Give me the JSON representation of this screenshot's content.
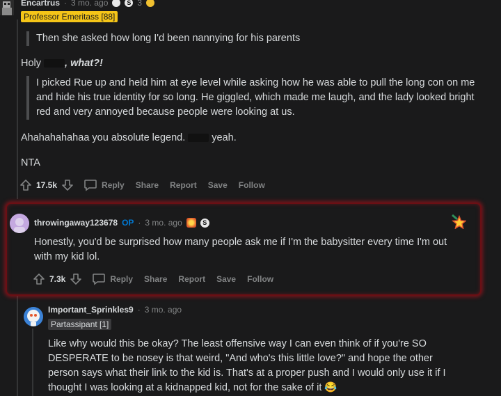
{
  "top_comment": {
    "username": "Encartrus",
    "time": "3 mo. ago",
    "award_count": "3",
    "flair": "Professor Emeritass [88]",
    "quote": "Then she asked how long I'd been nannying for his parents",
    "line1_prefix": "Holy ",
    "line1_emph": ", what?!",
    "paragraph": "I picked Rue up and held him at eye level while asking how he was able to pull the long con on me and hide his true identity for so long. He giggled, which made me laugh, and the lady looked bright red and very annoyed because people were looking at us.",
    "line3_prefix": "Ahahahahahaa you absolute legend. ",
    "line3_suffix": " yeah.",
    "line4": "NTA",
    "score": "17.5k",
    "actions": [
      "Reply",
      "Share",
      "Report",
      "Save",
      "Follow"
    ]
  },
  "highlighted_comment": {
    "username": "throwingaway123678",
    "op_badge": "OP",
    "time": "3 mo. ago",
    "body": "Honestly, you'd be surprised how many people ask me if I'm the babysitter every time I'm out with my kid lol.",
    "score": "7.3k",
    "actions": [
      "Reply",
      "Share",
      "Report",
      "Save",
      "Follow"
    ]
  },
  "reply_comment": {
    "username": "Important_Sprinkles9",
    "time": "3 mo. ago",
    "flair": "Partassipant [1]",
    "body": "Like why would this be okay? The least offensive way I can even think of if you're SO DESPERATE to be nosey is that weird, \"And who's this little love?\" and hope the other person says what their link to the kid is. That's at a proper push and I would only use it if I thought I was looking at a kidnapped kid, not for the sake of it 😂"
  },
  "colors": {
    "background": "#1a1a1b",
    "text": "#d7dadc",
    "muted": "#818384",
    "op_blue": "#0079d3",
    "flair_yellow": "#f5c518",
    "highlight_border": "#6b0f14"
  }
}
